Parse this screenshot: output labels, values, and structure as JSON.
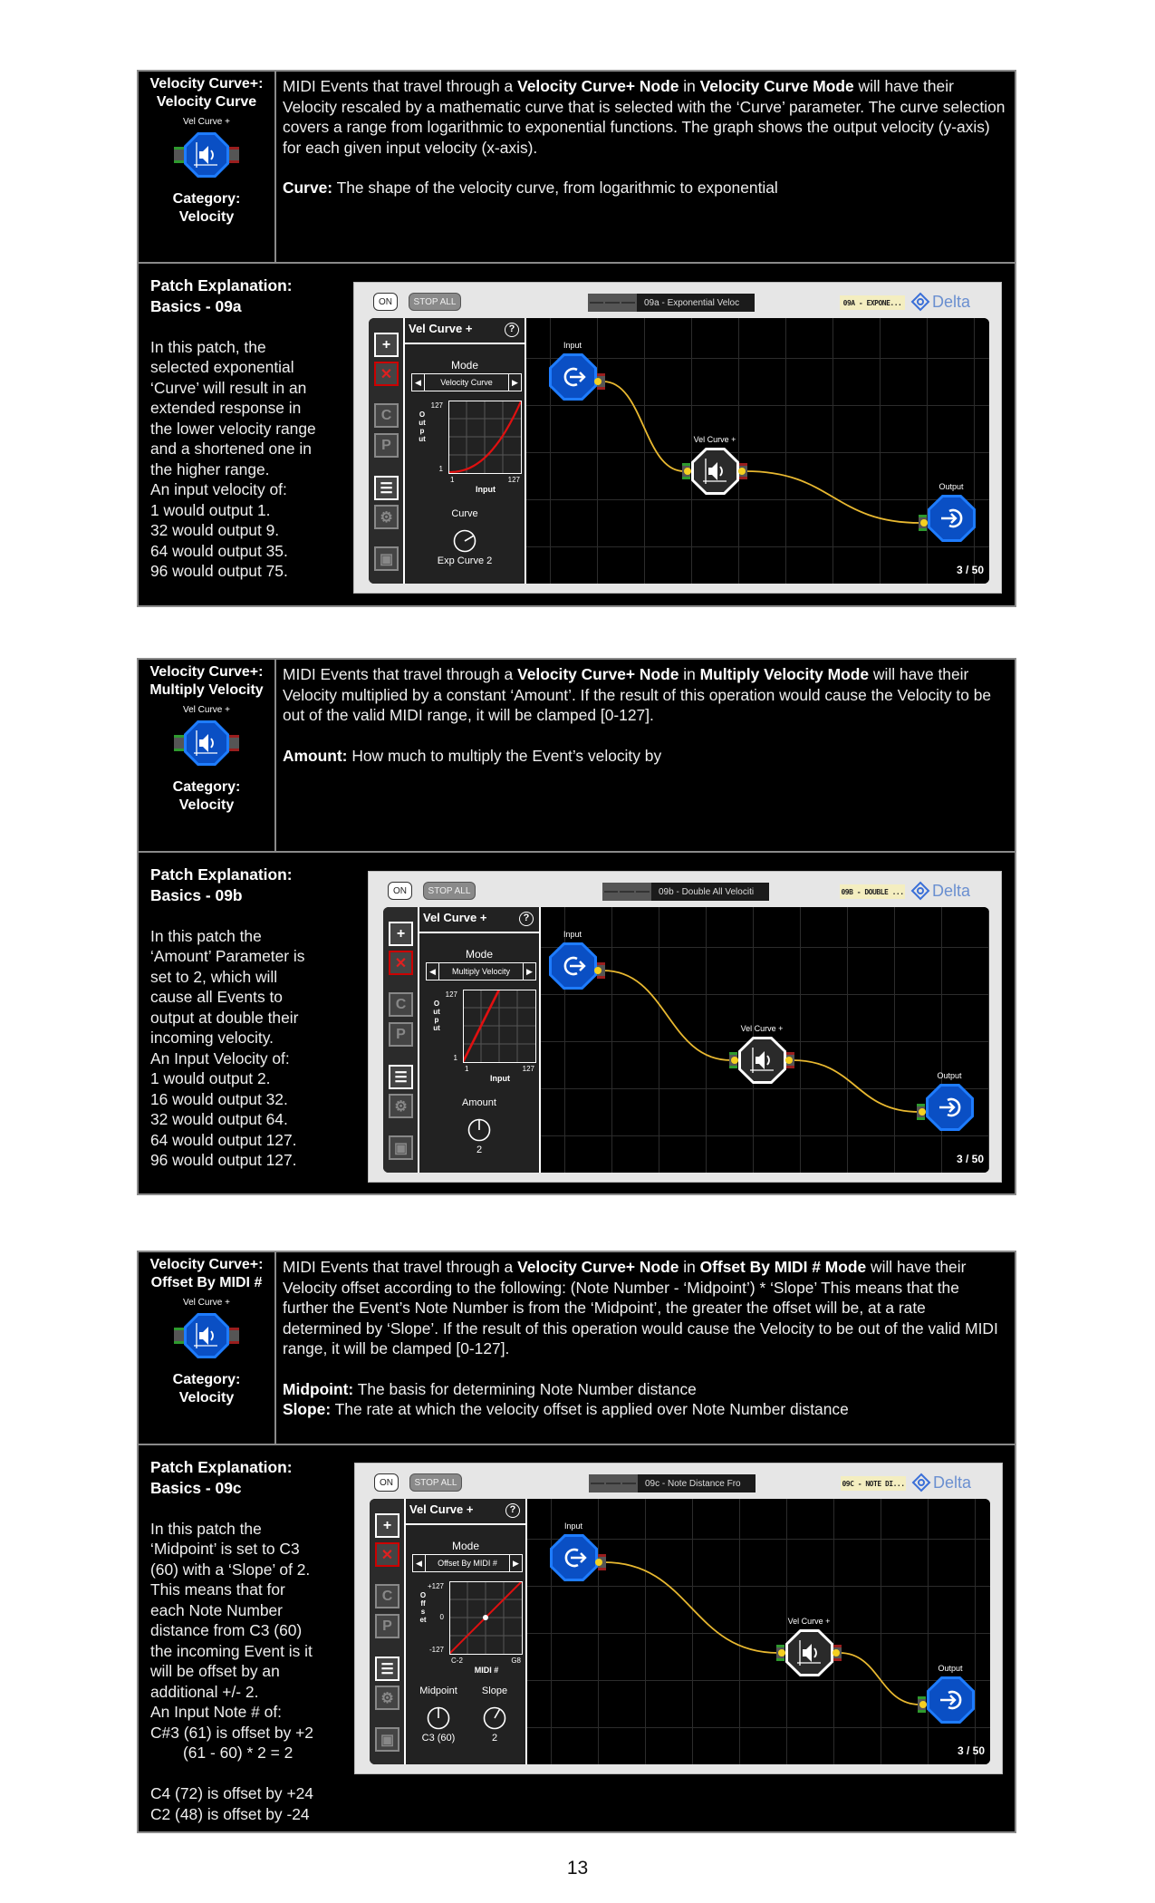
{
  "page_number": "13",
  "colors": {
    "node_blue": "#0a4fc4",
    "wire": "#e8b830",
    "graph_line": "#e01010",
    "port_in": "#2e9a2e",
    "port_out": "#9a1e1e"
  },
  "sections": [
    {
      "title_lines": [
        "Velocity Curve+:",
        "Velocity Curve"
      ],
      "icon_label": "Vel Curve +",
      "icon": "velocity-curve-node-icon",
      "category_lines": [
        "Category:",
        "Velocity"
      ],
      "description": [
        {
          "t": "MIDI Events that travel through a "
        },
        {
          "t": "Velocity Curve+ Node",
          "b": true
        },
        {
          "t": " in "
        },
        {
          "t": "Velocity Curve Mode",
          "b": true
        },
        {
          "t": " will have their Velocity rescaled by a mathematic curve that is selected with the ‘Curve’ parameter. The curve selection covers a range from logarithmic to exponential functions. The graph shows the output velocity (y-axis) for each given input velocity (x-axis)."
        }
      ],
      "params": [
        {
          "name": "Curve:",
          "text": " The shape of the velocity curve, from logarithmic to exponential"
        }
      ],
      "patch": {
        "heading": [
          "Patch Explanation:",
          "Basics - 09a"
        ],
        "body": [
          "In this patch, the",
          "selected exponential",
          "‘Curve’ will result in an",
          "extended response in",
          "the lower velocity range",
          "and a shortened one in",
          "the higher range.",
          "An input velocity of:",
          "1 would output 1.",
          "32 would output 9.",
          "64 would output 35.",
          "96 would output 75."
        ],
        "body2": []
      },
      "panel": {
        "on_label": "ON",
        "stop_label": "STOP ALL",
        "patch_name": "09a - Exponential Veloc",
        "tag": "09A - EXPONE...",
        "logo": "Delta",
        "node_title": "Vel Curve +",
        "help": "?",
        "mode_label": "Mode",
        "mode_value": "Velocity Curve",
        "graph": {
          "type": "exponential",
          "y_label": "Output",
          "y_top": "127",
          "y_mid": "",
          "y_bottom": "1",
          "x_left": "1",
          "x_right": "127",
          "x_label": "Input"
        },
        "knobs": [
          {
            "label": "Curve",
            "value": "Exp Curve 2",
            "level": 0.72
          }
        ],
        "nodes": {
          "input": "Input",
          "vel": "Vel Curve +",
          "output": "Output"
        },
        "page": "3 / 50"
      }
    },
    {
      "title_lines": [
        "Velocity Curve+:",
        "Multiply Velocity"
      ],
      "icon_label": "Vel Curve +",
      "icon": "velocity-curve-node-icon",
      "category_lines": [
        "Category:",
        "Velocity"
      ],
      "description": [
        {
          "t": "MIDI Events that travel through a "
        },
        {
          "t": "Velocity Curve+ Node",
          "b": true
        },
        {
          "t": " in "
        },
        {
          "t": "Multiply Velocity Mode",
          "b": true
        },
        {
          "t": " will have their Velocity multiplied by a constant ‘Amount’. If the result of this operation would cause the Velocity to be out of the valid MIDI range, it will be clamped [0-127]."
        }
      ],
      "params": [
        {
          "name": "Amount:",
          "text": " How much to multiply the Event’s velocity by"
        }
      ],
      "patch": {
        "heading": [
          "Patch Explanation:",
          "Basics - 09b"
        ],
        "body": [
          "In this patch the",
          "‘Amount’ Parameter is",
          "set to 2, which will",
          "cause all Events to",
          "output at double their",
          "incoming velocity.",
          "An Input Velocity of:",
          "1 would output 2.",
          "16 would output 32.",
          "32 would output 64.",
          "64 would output 127.",
          "96 would output 127."
        ],
        "body2": []
      },
      "panel": {
        "on_label": "ON",
        "stop_label": "STOP ALL",
        "patch_name": "09b - Double All Velociti",
        "tag": "09B - DOUBLE ...",
        "logo": "Delta",
        "node_title": "Vel Curve +",
        "help": "?",
        "mode_label": "Mode",
        "mode_value": "Multiply Velocity",
        "graph": {
          "type": "multiply",
          "y_label": "Output",
          "y_top": "127",
          "y_mid": "",
          "y_bottom": "1",
          "x_left": "1",
          "x_right": "127",
          "x_label": "Input"
        },
        "knobs": [
          {
            "label": "Amount",
            "value": "2",
            "level": 0.5
          }
        ],
        "nodes": {
          "input": "Input",
          "vel": "Vel Curve +",
          "output": "Output"
        },
        "page": "3 / 50"
      }
    },
    {
      "title_lines": [
        "Velocity Curve+:",
        "Offset By MIDI #"
      ],
      "icon_label": "Vel Curve +",
      "icon": "velocity-curve-node-icon",
      "category_lines": [
        "Category:",
        "Velocity"
      ],
      "description": [
        {
          "t": "MIDI Events that travel through a "
        },
        {
          "t": "Velocity Curve+ Node",
          "b": true
        },
        {
          "t": " in "
        },
        {
          "t": "Offset By MIDI # Mode",
          "b": true
        },
        {
          "t": " will have their Velocity offset according to the following: (Note Number - ‘Midpoint’) * ‘Slope’ This means that the further the Event’s Note Number is from the ‘Midpoint’, the greater the offset will be, at a rate determined by ‘Slope’. If the result of this operation would cause the Velocity to be out of the valid MIDI range, it will be clamped [0-127]."
        }
      ],
      "params": [
        {
          "name": "Midpoint:",
          "text": " The basis for determining Note Number distance"
        },
        {
          "name": "Slope:",
          "text": " The rate at which the velocity offset is applied over Note Number distance"
        }
      ],
      "patch": {
        "heading": [
          "Patch Explanation:",
          "Basics - 09c"
        ],
        "body": [
          "In this patch the",
          "‘Midpoint’ is set to C3",
          "(60) with a ‘Slope’ of 2.",
          "This means that for",
          "each Note Number",
          "distance from C3 (60)",
          "the incoming Event is it",
          "will be offset by an",
          "additional +/- 2.",
          "An Input Note # of:",
          "C#3 (61) is offset by +2",
          "(61 - 60) * 2 = 2"
        ],
        "body2": [
          "C4 (72) is offset by +24",
          "C2 (48) is offset by -24"
        ]
      },
      "panel": {
        "on_label": "ON",
        "stop_label": "STOP ALL",
        "patch_name": "09c - Note Distance Fro",
        "tag": "09C - NOTE DI...",
        "logo": "Delta",
        "node_title": "Vel Curve +",
        "help": "?",
        "mode_label": "Mode",
        "mode_value": "Offset By MIDI #",
        "graph": {
          "type": "offset",
          "y_label": "Offset",
          "y_top": "+127",
          "y_mid": "0",
          "y_bottom": "-127",
          "x_left": "C-2",
          "x_right": "G8",
          "x_label": "MIDI #"
        },
        "knobs": [
          {
            "label": "Midpoint",
            "value": "C3 (60)",
            "level": 0.5
          },
          {
            "label": "Slope",
            "value": "2",
            "level": 0.61
          }
        ],
        "nodes": {
          "input": "Input",
          "vel": "Vel Curve +",
          "output": "Output"
        },
        "page": "3 / 50"
      }
    }
  ]
}
